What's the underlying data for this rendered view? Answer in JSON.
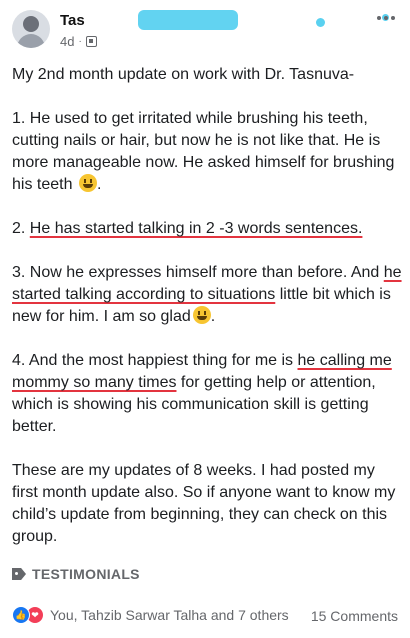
{
  "post": {
    "author_name": "Tas",
    "time": "4d",
    "separator": "·"
  },
  "content": {
    "intro": "My 2nd month update on work with Dr. Tasnuva-",
    "p1": "1. He used to get irritated while brushing his teeth, cutting nails or hair, but now he is not like that. He is more manageable now. He asked himself for brushing his teeth",
    "p2_prefix": "2. ",
    "p2_underlined": "He has started talking in 2 -3 words sentences.",
    "p3_prefix": "3. Now he expresses himself more than before. And ",
    "p3_underlined": "he started talking according to situations",
    "p3_suffix": " little bit which is new for him. I am so glad",
    "p4_prefix": "4. And the most happiest thing for me is ",
    "p4_underlined": "he calling me mommy so many times",
    "p4_suffix": " for getting help or attention, which is showing his communication skill is getting better.",
    "closing": "These are my updates of 8 weeks. I had posted my first month update also. So if anyone want to know my child’s update from beginning, they can check on this group."
  },
  "tag": {
    "label": "TESTIMONIALS"
  },
  "footer": {
    "reactions_text": "You, Tahzib Sarwar Talha and 7 others",
    "comments_text": "15 Comments"
  },
  "colors": {
    "underline": "#e3343f",
    "like": "#1877f2",
    "love": "#f33e58",
    "mask": "#5ad1f0"
  }
}
